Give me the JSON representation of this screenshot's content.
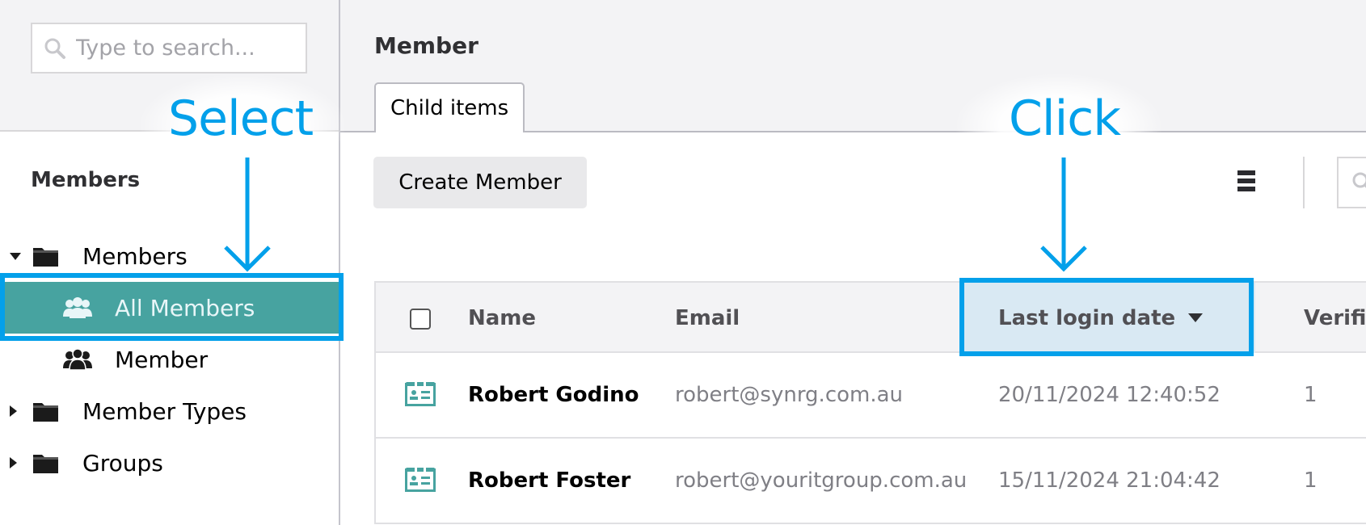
{
  "sidebar": {
    "search_placeholder": "Type to search...",
    "section_title": "Members",
    "tree": [
      {
        "label": "Members",
        "icon": "folder-icon",
        "expanded": true,
        "level": 0
      },
      {
        "label": "All Members",
        "icon": "people-icon",
        "selected": true,
        "level": 1
      },
      {
        "label": "Member",
        "icon": "people-icon",
        "level": 1
      },
      {
        "label": "Member Types",
        "icon": "folder-icon",
        "expanded": false,
        "level": 0
      },
      {
        "label": "Groups",
        "icon": "folder-icon",
        "expanded": false,
        "level": 0
      }
    ]
  },
  "header": {
    "title": "Member",
    "tabs": [
      {
        "label": "Child items",
        "active": true
      }
    ]
  },
  "toolbar": {
    "create_label": "Create Member",
    "menu_icon": "list-menu-icon",
    "search_icon": "search-icon"
  },
  "table": {
    "columns": [
      {
        "label": "Name"
      },
      {
        "label": "Email"
      },
      {
        "label": "Last login date",
        "sorted": "descending"
      },
      {
        "label": "Verifie"
      }
    ],
    "rows": [
      {
        "name": "Robert Godino",
        "email": "robert@synrg.com.au",
        "last_login": "20/11/2024 12:40:52",
        "verified": "1"
      },
      {
        "name": "Robert Foster",
        "email": "robert@youritgroup.com.au",
        "last_login": "15/11/2024 21:04:42",
        "verified": "1"
      }
    ]
  },
  "annotations": {
    "select_label": "Select",
    "click_label": "Click",
    "color": "#03a0ea"
  },
  "colors": {
    "selected_item_bg": "#47a3a0",
    "sorted_column_bg": "#d9e9f3",
    "annotation": "#03a0ea"
  }
}
